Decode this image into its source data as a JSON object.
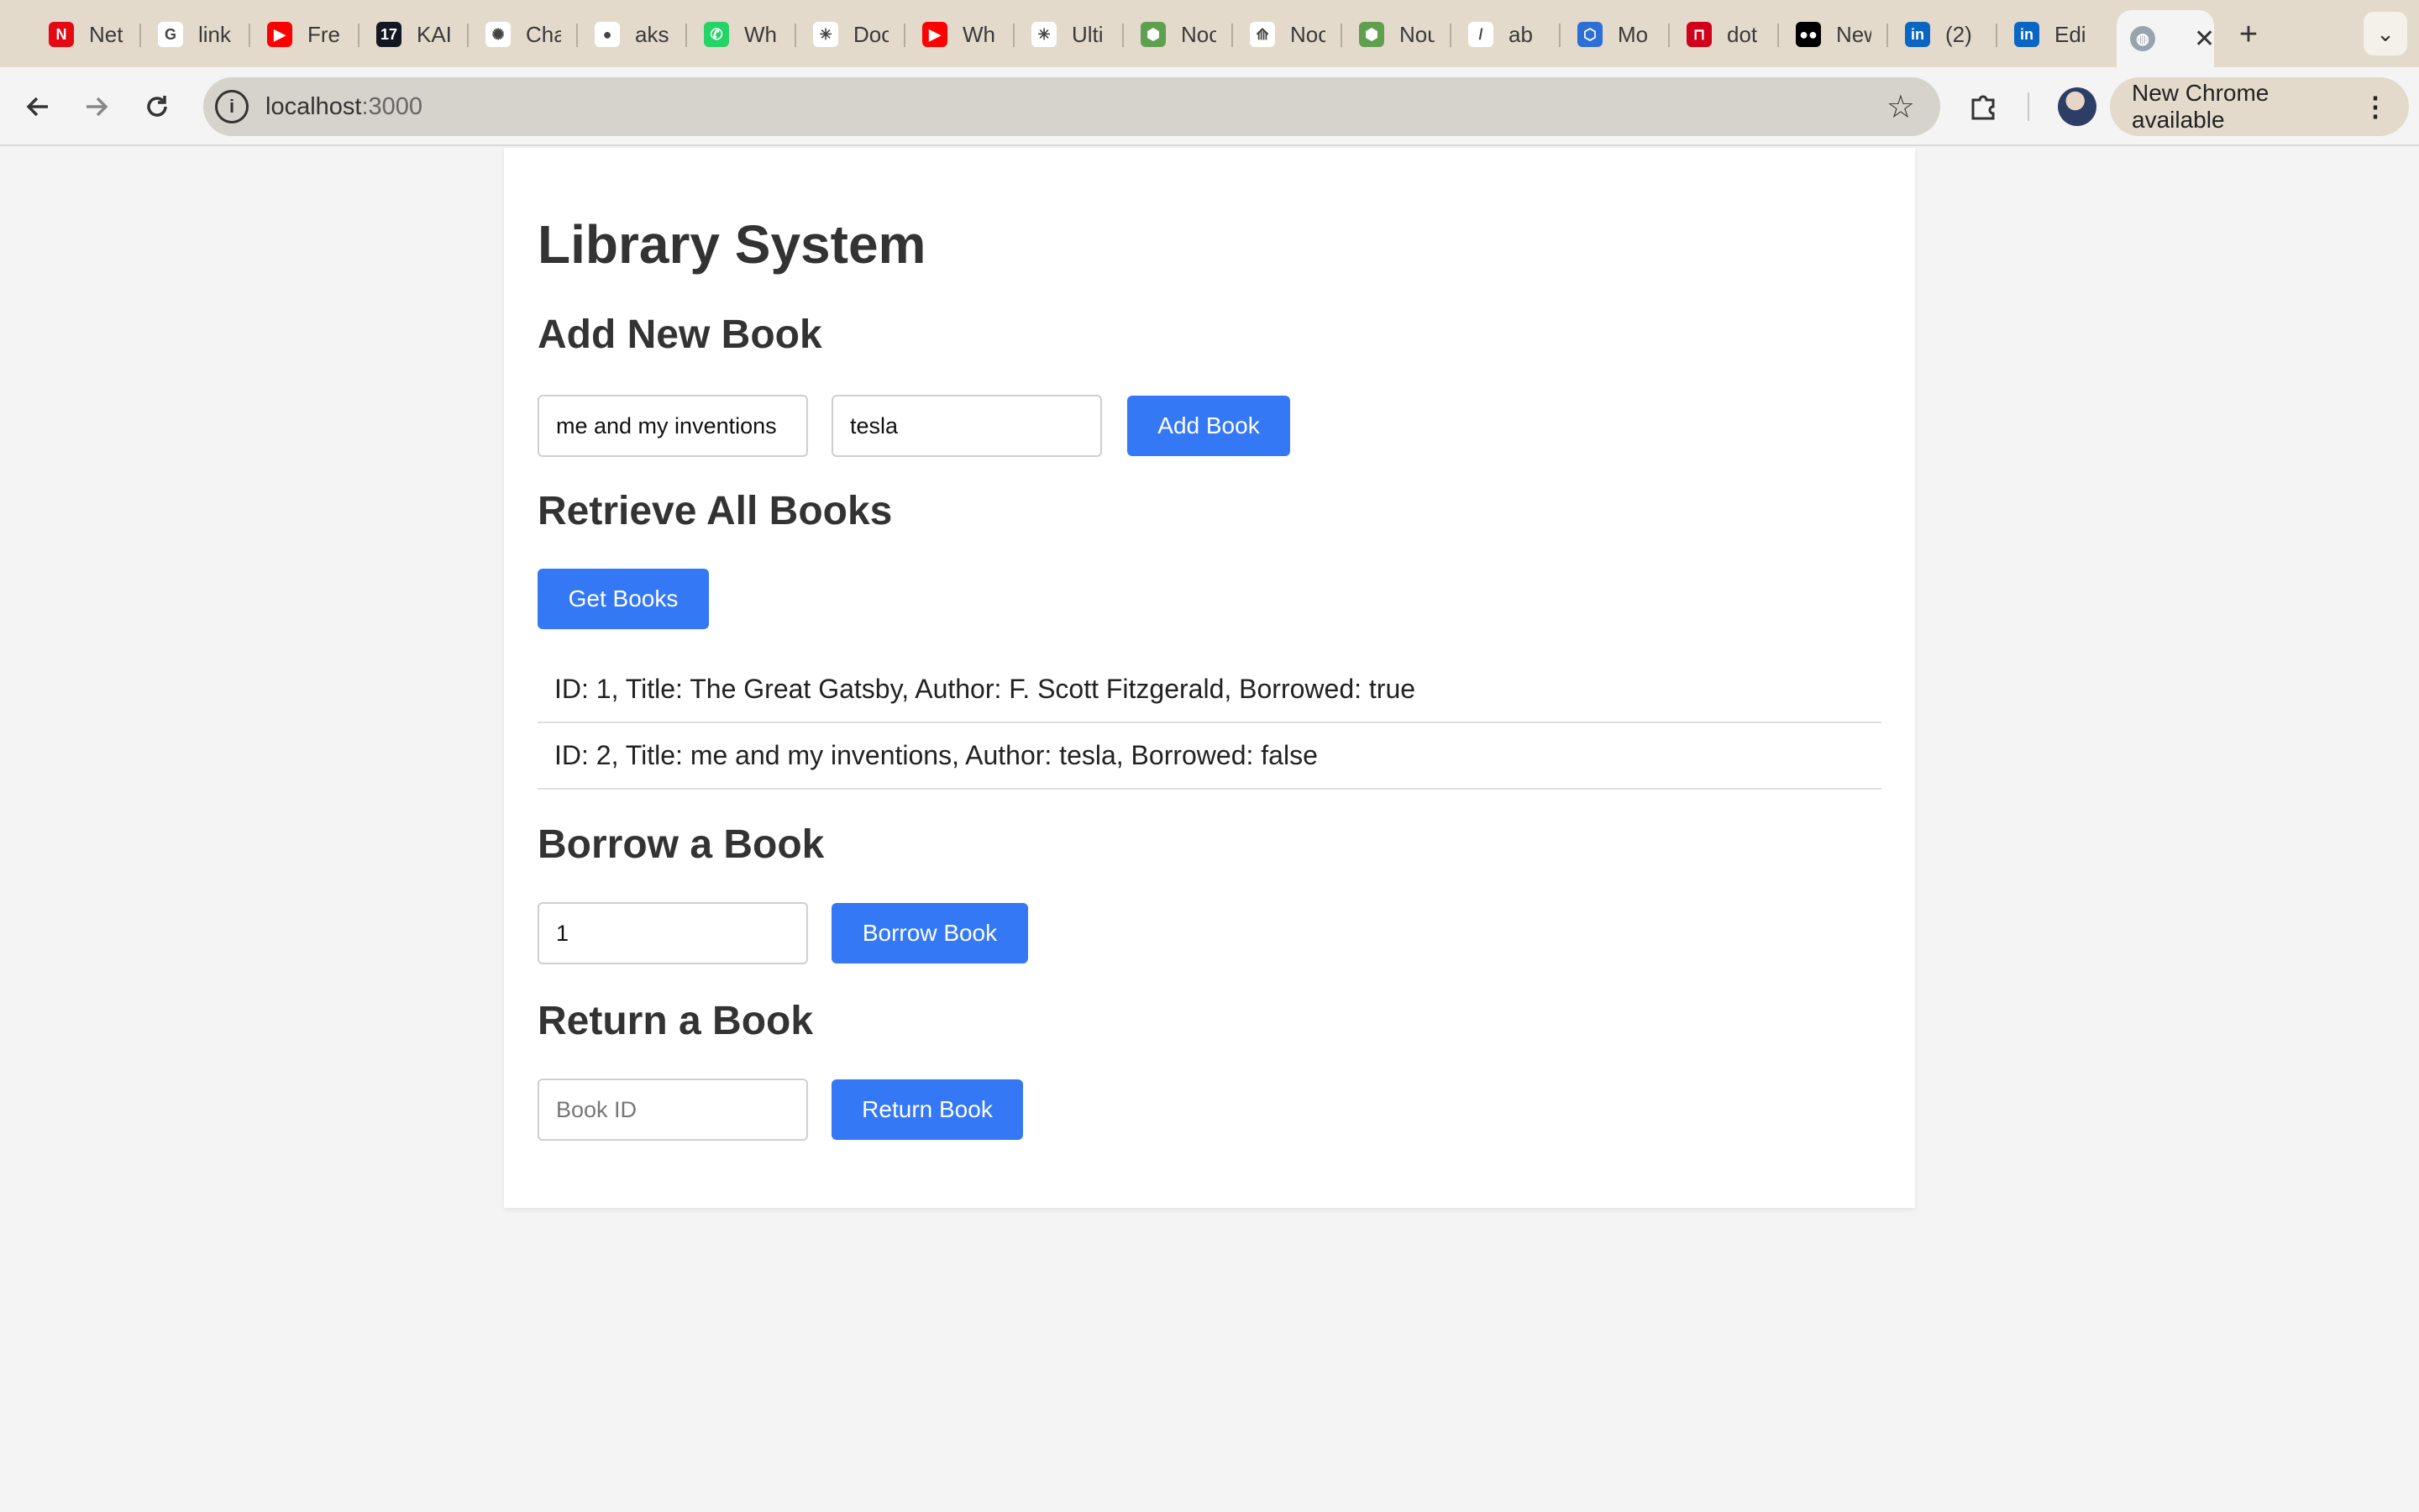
{
  "browser": {
    "tabs": [
      {
        "label": "Net",
        "icon": "netflix-icon",
        "color": "#e50914",
        "glyph": "N"
      },
      {
        "label": "link",
        "icon": "google-icon",
        "color": "#ffffff",
        "glyph": "G"
      },
      {
        "label": "Fre",
        "icon": "youtube-icon",
        "color": "#ff0000",
        "glyph": "▶"
      },
      {
        "label": "KAI",
        "icon": "tradingview-icon",
        "color": "#131722",
        "glyph": "17"
      },
      {
        "label": "Cha",
        "icon": "chatgpt-icon",
        "color": "#ffffff",
        "glyph": "✺"
      },
      {
        "label": "aks",
        "icon": "github-icon",
        "color": "#ffffff",
        "glyph": "●"
      },
      {
        "label": "Wh",
        "icon": "whatsapp-icon",
        "color": "#25d366",
        "glyph": "✆"
      },
      {
        "label": "Doc",
        "icon": "asterisk-icon",
        "color": "#ffffff",
        "glyph": "✳"
      },
      {
        "label": "Wh",
        "icon": "youtube-icon",
        "color": "#ff0000",
        "glyph": "▶"
      },
      {
        "label": "Ulti",
        "icon": "asterisk-icon",
        "color": "#ffffff",
        "glyph": "✳"
      },
      {
        "label": "Noc",
        "icon": "nodejs-icon",
        "color": "#5fa04e",
        "glyph": "⬢"
      },
      {
        "label": "Noc",
        "icon": "waves-icon",
        "color": "#ffffff",
        "glyph": "⟰"
      },
      {
        "label": "Nou",
        "icon": "nodejs-icon",
        "color": "#5fa04e",
        "glyph": "⬢"
      },
      {
        "label": "ab",
        "icon": "pen-icon",
        "color": "#ffffff",
        "glyph": "/"
      },
      {
        "label": "Mo",
        "icon": "cube-icon",
        "color": "#2d6fd6",
        "glyph": "⬡"
      },
      {
        "label": "dot",
        "icon": "bracket-icon",
        "color": "#d0021b",
        "glyph": "⊓"
      },
      {
        "label": "New",
        "icon": "medium-icon",
        "color": "#000000",
        "glyph": "●●"
      },
      {
        "label": "(2)",
        "icon": "linkedin-icon",
        "color": "#0a66c2",
        "glyph": "in"
      },
      {
        "label": "Edi",
        "icon": "linkedin-icon",
        "color": "#0a66c2",
        "glyph": "in"
      }
    ],
    "active_tab": {
      "icon": "globe-icon",
      "close": "✕"
    },
    "new_tab": "+",
    "tab_menu": "⌄",
    "url_host": "localhost",
    "url_port": ":3000",
    "update_label": "New Chrome available",
    "update_menu": "⋮"
  },
  "app": {
    "title": "Library System",
    "add_section": {
      "heading": "Add New Book",
      "title_value": "me and my inventions",
      "author_value": "tesla",
      "button": "Add Book"
    },
    "retrieve_section": {
      "heading": "Retrieve All Books",
      "button": "Get Books",
      "books": [
        "ID: 1, Title: The Great Gatsby, Author: F. Scott Fitzgerald, Borrowed: true",
        "ID: 2, Title: me and my inventions, Author: tesla, Borrowed: false"
      ]
    },
    "borrow_section": {
      "heading": "Borrow a Book",
      "id_value": "1",
      "button": "Borrow Book"
    },
    "return_section": {
      "heading": "Return a Book",
      "id_placeholder": "Book ID",
      "button": "Return Book"
    }
  }
}
